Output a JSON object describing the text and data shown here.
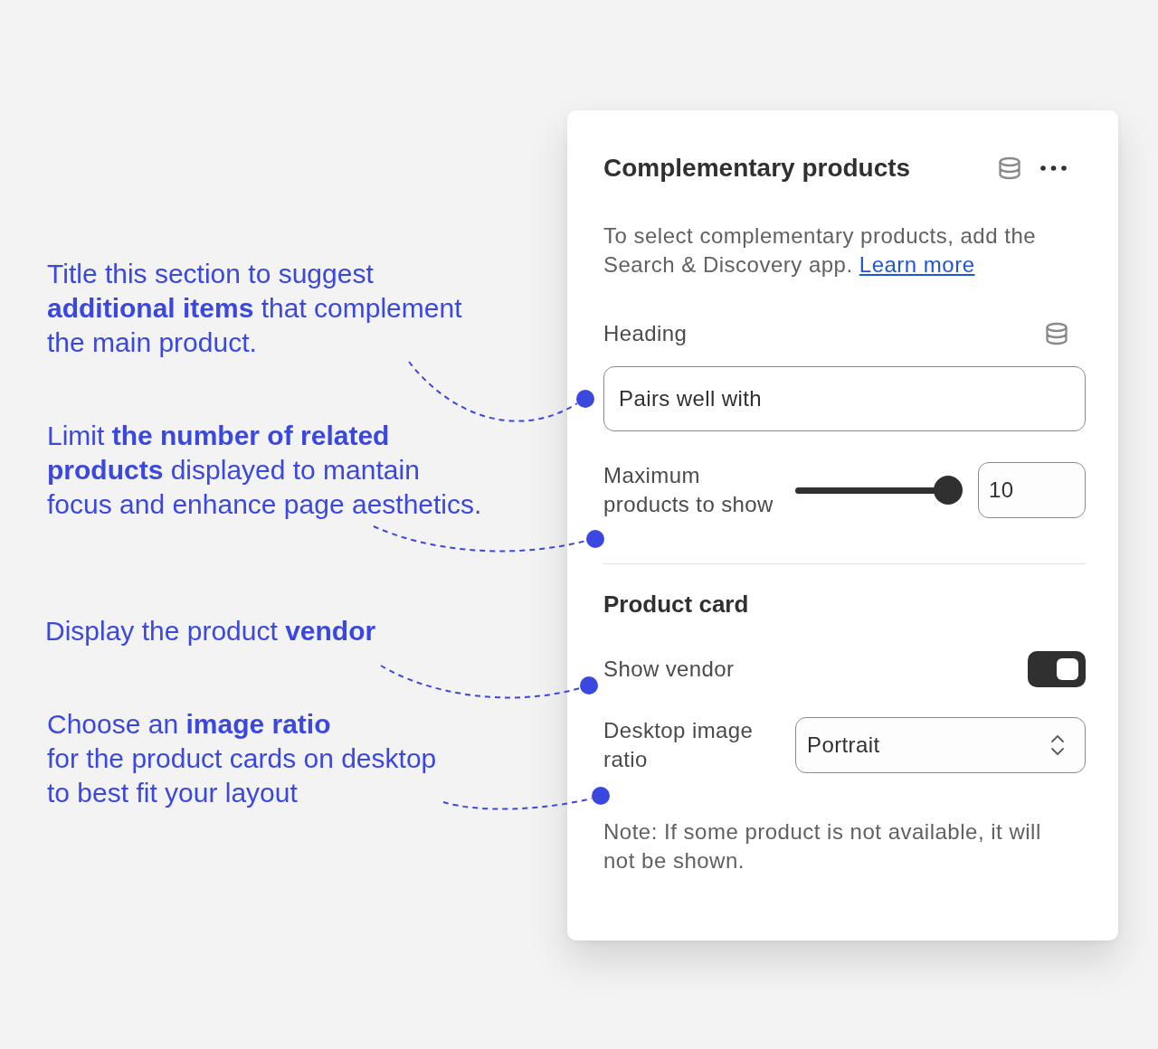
{
  "annotations": [
    {
      "text": "Title this section to suggest\n**additional items** that complement\nthe main product."
    },
    {
      "text": "Limit **the number of related\nproducts** displayed to mantain\nfocus and enhance page aesthetics."
    },
    {
      "text": "Display the product **vendor**"
    },
    {
      "text": "Choose an **image ratio**\nfor the product cards on desktop\nto best fit your layout"
    }
  ],
  "panel": {
    "title": "Complementary products",
    "description": "To select complementary products, add the Search & Discovery app.",
    "link": "Learn more",
    "sections": [
      {
        "fields": [
          {
            "kind": "text",
            "label": "Heading",
            "value": "Pairs well with"
          },
          {
            "kind": "range",
            "label": "Maximum products to show",
            "level": 1,
            "value": "10"
          }
        ]
      },
      {
        "heading": "Product card",
        "fields": [
          {
            "kind": "toggle",
            "label": "Show vendor",
            "on": true
          },
          {
            "kind": "select",
            "label": "Desktop image ratio",
            "value": "Portrait"
          }
        ]
      }
    ],
    "note": "Note: If some product is not available, it will not be shown."
  }
}
